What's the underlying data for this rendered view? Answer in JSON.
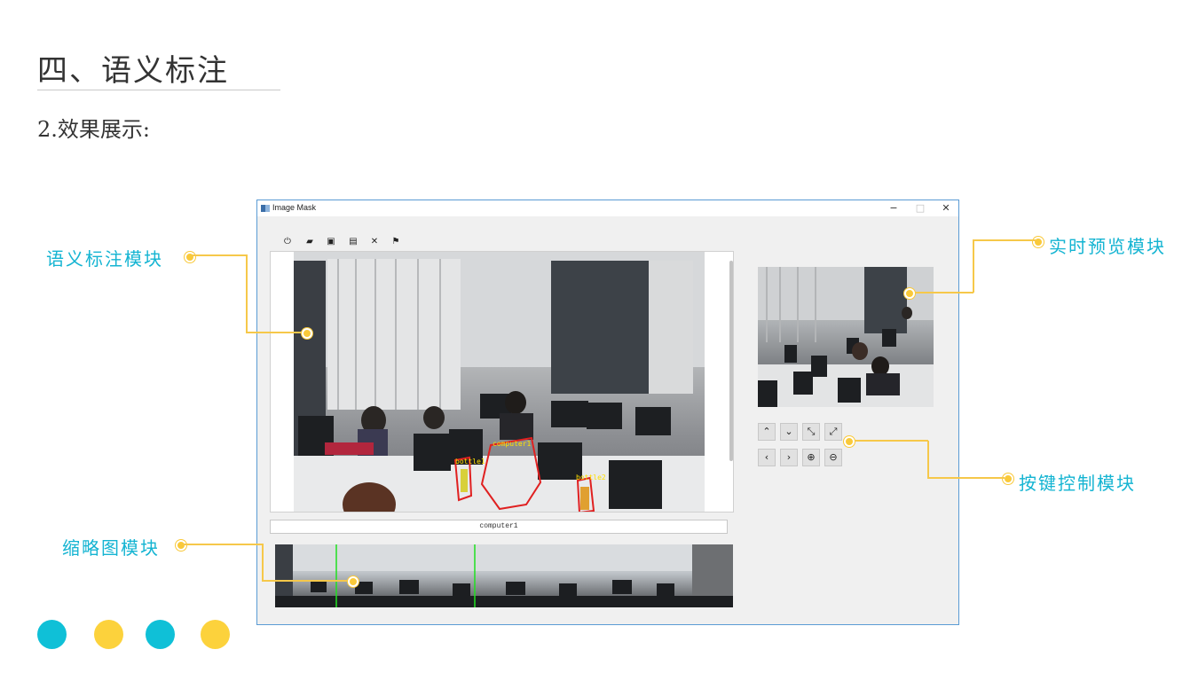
{
  "slide": {
    "title": "四、语义标注",
    "subtitle": "2.效果展示:"
  },
  "callouts": {
    "annotation": "语义标注模块",
    "preview": "实时预览模块",
    "keys": "按键控制模块",
    "thumbnail": "缩略图模块"
  },
  "window": {
    "title": "Image Mask",
    "controls": {
      "minimize": "−",
      "maximize": "□",
      "close": "✕"
    }
  },
  "toolbar": {
    "icons": [
      "power-icon",
      "open-folder-icon",
      "save-icon",
      "save-as-icon",
      "close-icon",
      "flag-icon"
    ],
    "glyphs": [
      "⏻",
      "▰",
      "▣",
      "▤",
      "✕",
      "⚑"
    ]
  },
  "annotation": {
    "labels": {
      "computer": "computer1",
      "bottle1": "bottle1",
      "bottle2": "bottle2"
    },
    "current_label": "computer1"
  },
  "key_controls": {
    "row1": {
      "up": "⌃",
      "down": "⌄",
      "shrink": "⤡",
      "expand": "⤢"
    },
    "row2": {
      "left": "‹",
      "right": "›",
      "zoom_in": "⊕",
      "zoom_out": "⊖"
    }
  },
  "colors": {
    "callout_text": "#14b4d2",
    "callout_line": "#f6c84a",
    "deco_cyan": "#0fc0d7",
    "deco_yellow": "#fcd23c",
    "mask_outline": "#e02020",
    "label_text": "#ffe000",
    "thumb_marker": "#20e020"
  }
}
